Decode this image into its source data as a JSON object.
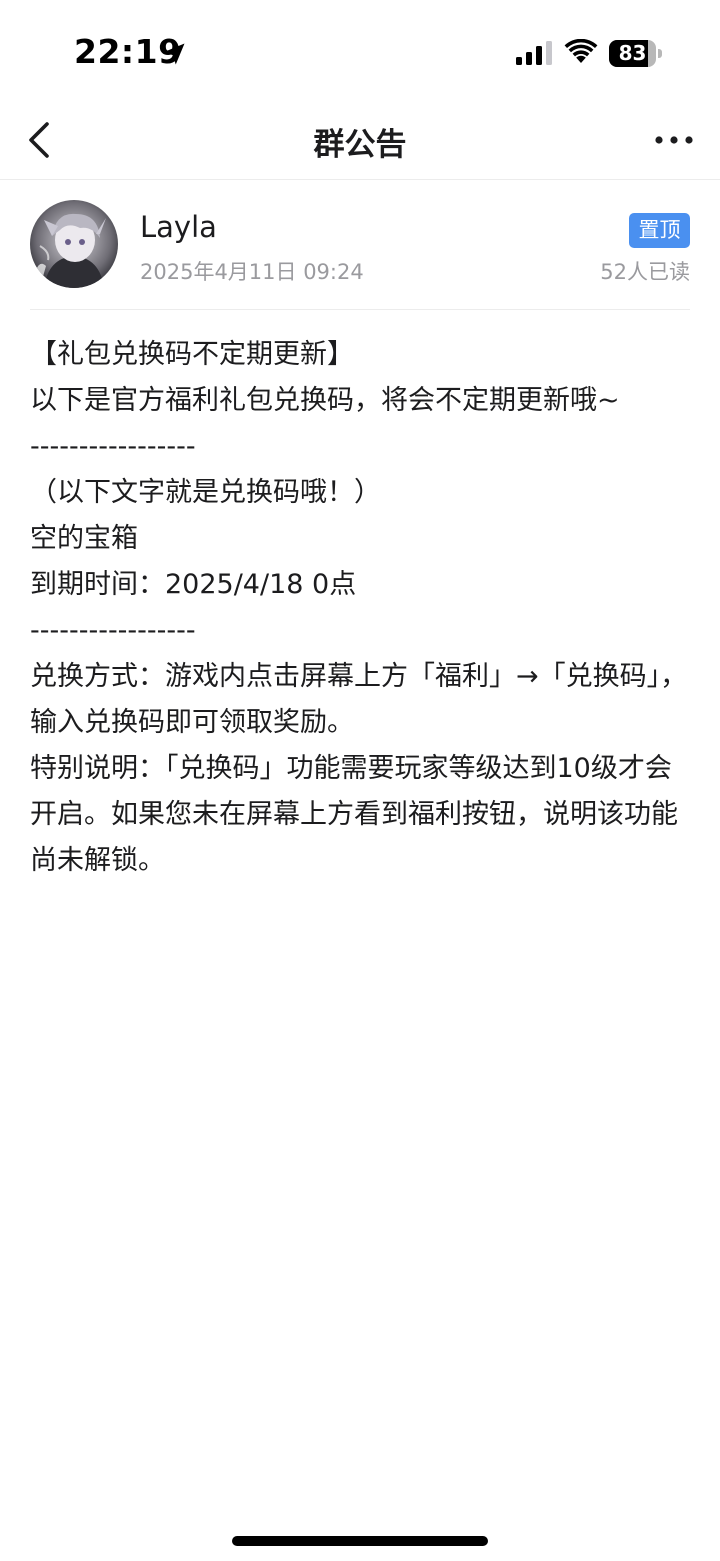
{
  "status_bar": {
    "time": "22:19",
    "battery_level": "83",
    "battery_fraction": 0.83
  },
  "nav": {
    "title": "群公告",
    "back_icon": "chevron-left-icon",
    "more_icon": "more-dots-icon"
  },
  "post": {
    "author": "Layla",
    "datetime": "2025年4月11日 09:24",
    "badge": "置顶",
    "read_count": "52人已读",
    "badge_color": "#4a90f0"
  },
  "content": {
    "lines": [
      "【礼包兑换码不定期更新】",
      "以下是官方福利礼包兑换码，将会不定期更新哦~",
      "-----------------",
      "（以下文字就是兑换码哦！）",
      "空的宝箱",
      "到期时间：2025/4/18 0点",
      "-----------------",
      "兑换方式：游戏内点击屏幕上方「福利」→「兑换码」，输入兑换码即可领取奖励。",
      "特别说明：「兑换码」功能需要玩家等级达到10级才会开启。如果您未在屏幕上方看到福利按钮，说明该功能尚未解锁。"
    ]
  }
}
